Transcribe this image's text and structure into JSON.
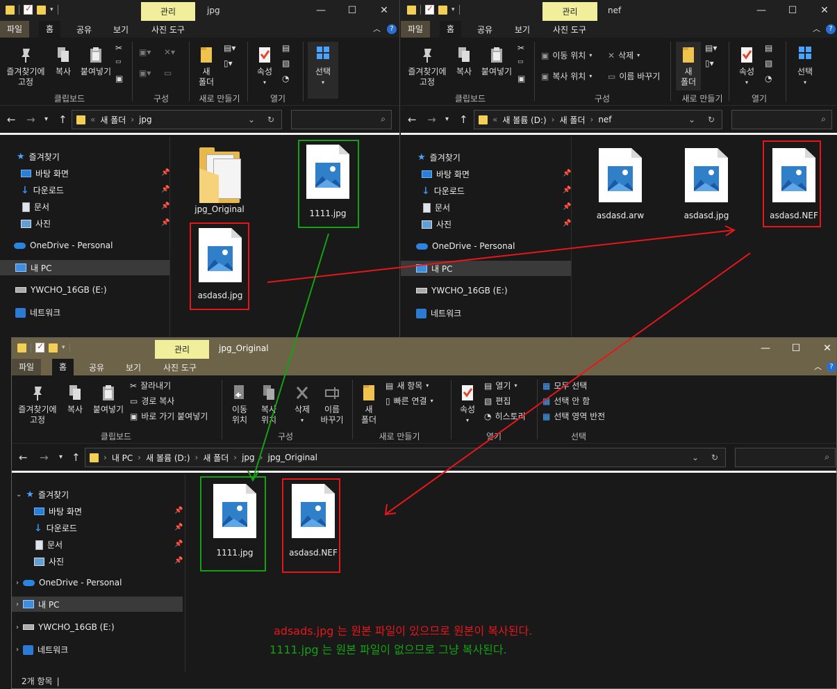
{
  "windows": {
    "jpg": {
      "manage_tab": "관리",
      "title": "jpg",
      "menus": [
        "파일",
        "홈",
        "공유",
        "보기",
        "사진 도구"
      ],
      "address": {
        "overflow": "«",
        "parts": [
          "새 폴더",
          "jpg"
        ]
      },
      "files": [
        {
          "name": "jpg_Original",
          "type": "folder"
        },
        {
          "name": "1111.jpg",
          "type": "image"
        },
        {
          "name": "asdasd.jpg",
          "type": "image"
        }
      ]
    },
    "nef": {
      "manage_tab": "관리",
      "title": "nef",
      "menus": [
        "파일",
        "홈",
        "공유",
        "보기",
        "사진 도구"
      ],
      "address": {
        "overflow": "«",
        "parts": [
          "새 볼륨 (D:)",
          "새 폴더",
          "nef"
        ]
      },
      "files": [
        {
          "name": "asdasd.arw",
          "type": "image"
        },
        {
          "name": "asdasd.jpg",
          "type": "image"
        },
        {
          "name": "asdasd.NEF",
          "type": "image"
        }
      ]
    },
    "orig": {
      "manage_tab": "관리",
      "title": "jpg_Original",
      "menus": [
        "파일",
        "홈",
        "공유",
        "보기",
        "사진 도구"
      ],
      "address": {
        "parts": [
          "내 PC",
          "새 볼륨 (D:)",
          "새 폴더",
          "jpg",
          "jpg_Original"
        ]
      },
      "files": [
        {
          "name": "1111.jpg",
          "type": "image"
        },
        {
          "name": "asdasd.NEF",
          "type": "image"
        }
      ],
      "status": "2개 항목"
    }
  },
  "ribbon": {
    "pin": "즐겨찾기에\n고정",
    "copy": "복사",
    "paste": "붙여넣기",
    "cut": "잘라내기",
    "copy_path": "경로 복사",
    "paste_shortcut": "바로 가기 붙여넣기",
    "move_to": "이동\n위치",
    "copy_to": "복사\n위치",
    "move_to_inline": "이동 위치",
    "copy_to_inline": "복사 위치",
    "delete": "삭제",
    "rename": "이름\n바꾸기",
    "rename_inline": "이름 바꾸기",
    "new_folder": "새\n폴더",
    "new_item": "새 항목",
    "easy_access": "빠른 연결",
    "properties": "속성",
    "open": "열기",
    "edit": "편집",
    "history": "히스토리",
    "select": "선택",
    "select_all": "모두 선택",
    "select_none": "선택 안 함",
    "invert_selection": "선택 영역 반전",
    "groups": {
      "clipboard": "클립보드",
      "organize": "구성",
      "new": "새로 만들기",
      "open": "열기",
      "select": "선택"
    }
  },
  "nav_pane": {
    "quick_access": "즐겨찾기",
    "desktop": "바탕 화면",
    "downloads": "다운로드",
    "documents": "문서",
    "pictures": "사진",
    "onedrive": "OneDrive - Personal",
    "this_pc": "내 PC",
    "usb": "YWCHO_16GB (E:)",
    "network": "네트워크"
  },
  "annotations": {
    "red": "adsads.jpg 는 원본 파일이 있으므로 원본이 복사된다.",
    "green": "1111.jpg 는 원본 파일이 없으므로 그냥 복사된다.",
    "colors": {
      "red": "#e8161b",
      "green": "#14a114"
    }
  },
  "colors": {
    "manage_tab": "#f1ef9b",
    "file_tab": "#51493a",
    "highlight_red": "#e8161b",
    "highlight_green": "#14a114"
  }
}
